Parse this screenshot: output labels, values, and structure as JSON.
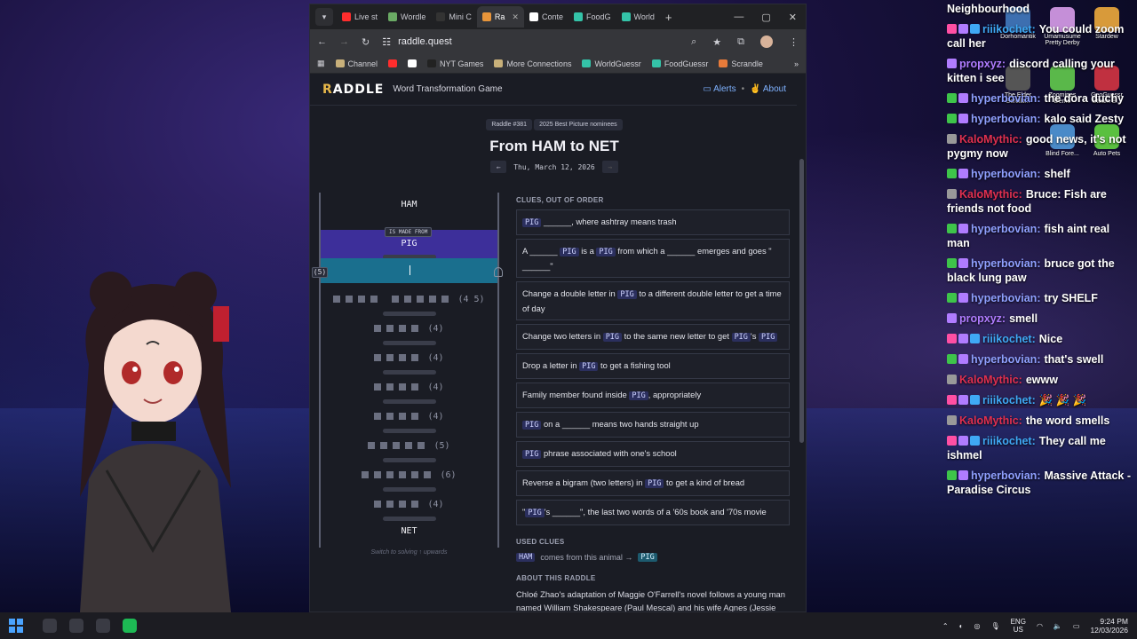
{
  "browser": {
    "tabs": [
      {
        "label": "Live st",
        "color": "#ff2d2d",
        "active": false
      },
      {
        "label": "Wordle",
        "color": "#6aaa64",
        "active": false
      },
      {
        "label": "Mini C",
        "color": "#333333",
        "active": false
      },
      {
        "label": "Ra",
        "color": "#e8953a",
        "active": true
      },
      {
        "label": "Conte",
        "color": "#ffffff",
        "active": false
      },
      {
        "label": "FoodG",
        "color": "#34c3a8",
        "active": false
      },
      {
        "label": "World",
        "color": "#34c3a8",
        "active": false
      }
    ],
    "url": "raddle.quest",
    "bookmarks": [
      {
        "label": "Channel",
        "icon": "folder-icon"
      },
      {
        "label": "",
        "icon": "youtube-icon"
      },
      {
        "label": "",
        "icon": "x-icon"
      },
      {
        "label": "NYT Games",
        "icon": "nyt-icon"
      },
      {
        "label": "More Connections",
        "icon": "folder-icon"
      },
      {
        "label": "WorldGuessr",
        "icon": "globe-icon"
      },
      {
        "label": "FoodGuessr",
        "icon": "globe-icon"
      },
      {
        "label": "Scrandle",
        "icon": "scrandle-icon"
      }
    ]
  },
  "raddle": {
    "logo": "RADDLE",
    "tagline": "Word Transformation Game",
    "nav": {
      "alerts": "Alerts",
      "sep": "•",
      "about": "About"
    },
    "puzzle_no": "Raddle #381",
    "theme": "2025 Best Picture nominees",
    "title": "From HAM to NET",
    "date": "Thu, March 12, 2026",
    "prev": "←",
    "next": "→",
    "ladder": {
      "start": "HAM",
      "made_from": "IS MADE FROM",
      "solved": "PIG",
      "active_len": "(5)",
      "rows": [
        {
          "len": "(4 5)",
          "pattern": [
            4,
            5
          ]
        },
        {
          "len": "(4)",
          "pattern": [
            4
          ]
        },
        {
          "len": "(4)",
          "pattern": [
            4
          ]
        },
        {
          "len": "(4)",
          "pattern": [
            4
          ]
        },
        {
          "len": "(4)",
          "pattern": [
            4
          ]
        },
        {
          "len": "(5)",
          "pattern": [
            5
          ]
        },
        {
          "len": "(6)",
          "pattern": [
            6
          ]
        },
        {
          "len": "(4)",
          "pattern": [
            4
          ]
        }
      ],
      "end": "NET",
      "hint": "Switch to solving ↑ upwards"
    },
    "clues_heading": "CLUES, OUT OF ORDER",
    "clues": [
      [
        "",
        "PIG",
        " ______, where ashtray means trash"
      ],
      [
        "A ______ ",
        "PIG",
        " is a ",
        "PIG",
        " from which a ______ emerges and goes \" ______\""
      ],
      [
        "Change a double letter in ",
        "PIG",
        " to a different double letter to get a time of day"
      ],
      [
        "Change two letters in ",
        "PIG",
        " to the same new letter to get ",
        "PIG",
        "'s ",
        "PIG",
        ""
      ],
      [
        "Drop a letter in ",
        "PIG",
        " to get a fishing tool"
      ],
      [
        "Family member found inside ",
        "PIG",
        ", appropriately"
      ],
      [
        "",
        "PIG",
        " on a ______ means two hands straight up"
      ],
      [
        "",
        "PIG",
        " phrase associated with one's school"
      ],
      [
        "Reverse a bigram (two letters) in ",
        "PIG",
        " to get a kind of bread"
      ],
      [
        "\"",
        "PIG",
        "'s ______\", the last two words of a '60s book and '70s movie"
      ]
    ],
    "used_heading": "USED CLUES",
    "used": {
      "from": "HAM",
      "text": "comes from this animal →",
      "to": "PIG"
    },
    "about_heading": "ABOUT THIS RADDLE",
    "about_text": "Chloé Zhao's adaptation of Maggie O'Farrell's novel follows a young man named William Shakespeare (Paul Mescal) and his wife Agnes (Jessie Buckley) and their three children, until one gets sick and"
  },
  "desktop_icons": [
    {
      "label": "Dorhomantik",
      "color": "#3d6fb0"
    },
    {
      "label": "Umamusume Pretty Derby",
      "color": "#c58fd8"
    },
    {
      "label": "Stardew",
      "color": "#d89a3a"
    },
    {
      "label": "The Elder Scrolls...",
      "color": "#555"
    },
    {
      "label": "Zoomines Demo",
      "color": "#5ab84a"
    },
    {
      "label": "GeoGuessr Steam E...",
      "color": "#c03040"
    },
    {
      "label": "Blind Fore...",
      "color": "#4a8ac8"
    },
    {
      "label": "Auto Pets",
      "color": "#5ac040"
    }
  ],
  "chat": [
    {
      "name": "",
      "text": "Neighbourhood",
      "badges": [],
      "color": "#ffffff"
    },
    {
      "name": "riiikochet:",
      "text": "You could zoom call her",
      "badges": [
        "#ff4fa3",
        "#b07cff",
        "#3fa9f5"
      ],
      "color": "#3fa9f5"
    },
    {
      "name": "propxyz:",
      "text": "discord calling your kitten i see",
      "badges": [
        "#b07cff"
      ],
      "color": "#b07cff"
    },
    {
      "name": "hyperbovian:",
      "text": "the dora duchy",
      "badges": [
        "#3ec44a",
        "#b07cff"
      ],
      "color": "#8fa0ff"
    },
    {
      "name": "hyperbovian:",
      "text": "kalo said Zesty",
      "badges": [
        "#3ec44a",
        "#b07cff"
      ],
      "color": "#8fa0ff"
    },
    {
      "name": "KaloMythic:",
      "text": "good news, it's not pygmy now",
      "badges": [
        "#999999"
      ],
      "color": "#e03050"
    },
    {
      "name": "hyperbovian:",
      "text": "shelf",
      "badges": [
        "#3ec44a",
        "#b07cff"
      ],
      "color": "#8fa0ff"
    },
    {
      "name": "KaloMythic:",
      "text": "Bruce: Fish are friends not food",
      "badges": [
        "#999999"
      ],
      "color": "#e03050"
    },
    {
      "name": "hyperbovian:",
      "text": "fish aint real man",
      "badges": [
        "#3ec44a",
        "#b07cff"
      ],
      "color": "#8fa0ff"
    },
    {
      "name": "hyperbovian:",
      "text": "bruce got the black lung paw",
      "badges": [
        "#3ec44a",
        "#b07cff"
      ],
      "color": "#8fa0ff"
    },
    {
      "name": "hyperbovian:",
      "text": "try SHELF",
      "badges": [
        "#3ec44a",
        "#b07cff"
      ],
      "color": "#8fa0ff"
    },
    {
      "name": "propxyz:",
      "text": "smell",
      "badges": [
        "#b07cff"
      ],
      "color": "#b07cff"
    },
    {
      "name": "riiikochet:",
      "text": "Nice",
      "badges": [
        "#ff4fa3",
        "#b07cff",
        "#3fa9f5"
      ],
      "color": "#3fa9f5"
    },
    {
      "name": "hyperbovian:",
      "text": "that's swell",
      "badges": [
        "#3ec44a",
        "#b07cff"
      ],
      "color": "#8fa0ff"
    },
    {
      "name": "KaloMythic:",
      "text": "ewww",
      "badges": [
        "#999999"
      ],
      "color": "#e03050"
    },
    {
      "name": "riiikochet:",
      "text": "🎉 🎉 🎉",
      "badges": [
        "#ff4fa3",
        "#b07cff",
        "#3fa9f5"
      ],
      "color": "#3fa9f5"
    },
    {
      "name": "KaloMythic:",
      "text": "the word smells",
      "badges": [
        "#999999"
      ],
      "color": "#e03050"
    },
    {
      "name": "riiikochet:",
      "text": "They call me ishmel",
      "badges": [
        "#ff4fa3",
        "#b07cff",
        "#3fa9f5"
      ],
      "color": "#3fa9f5"
    },
    {
      "name": "hyperbovian:",
      "text": "Massive Attack - Paradise Circus",
      "badges": [
        "#3ec44a",
        "#b07cff"
      ],
      "color": "#8fa0ff"
    }
  ],
  "taskbar": {
    "lang_top": "ENG",
    "lang_bottom": "US",
    "time": "9:24 PM",
    "date": "12/03/2026"
  }
}
